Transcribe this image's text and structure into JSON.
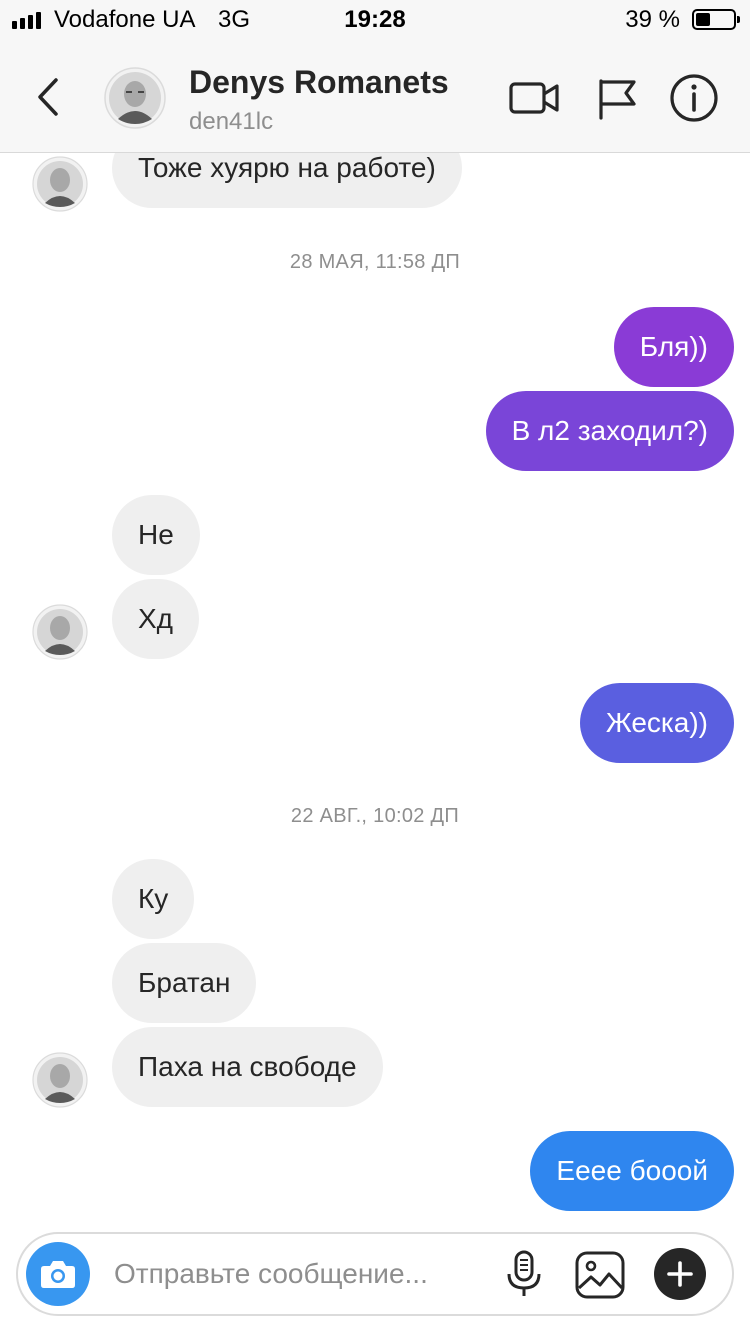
{
  "status_bar": {
    "carrier": "Vodafone UA",
    "network": "3G",
    "time": "19:28",
    "battery_text": "39 %",
    "battery_level": 0.39
  },
  "header": {
    "name": "Denys Romanets",
    "username": "den41lc",
    "icons": [
      "back-chevron-icon",
      "video-camera-icon",
      "flag-icon",
      "info-icon"
    ]
  },
  "messages": [
    {
      "direction": "in",
      "text": "Тоже хуярю на работе)"
    },
    {
      "type": "timestamp",
      "text": "28 МАЯ, 11:58 ДП"
    },
    {
      "direction": "out",
      "text": "Бля))",
      "color": "#8a3bd6"
    },
    {
      "direction": "out",
      "text": "В л2 заходил?)",
      "color": "#7a45d8"
    },
    {
      "direction": "in",
      "text": "Не"
    },
    {
      "direction": "in",
      "text": "Хд"
    },
    {
      "direction": "out",
      "text": "Жеска))",
      "color": "#5a5fe0"
    },
    {
      "type": "timestamp",
      "text": "22 АВГ., 10:02 ДП"
    },
    {
      "direction": "in",
      "text": "Ку"
    },
    {
      "direction": "in",
      "text": "Братан"
    },
    {
      "direction": "in",
      "text": "Паха на свободе"
    },
    {
      "direction": "out",
      "text": "Еeee бoooй",
      "color": "#2f86ef"
    }
  ],
  "composer": {
    "placeholder": "Отправьте сообщение...",
    "value": "",
    "icons": [
      "camera-icon",
      "microphone-icon",
      "gallery-icon",
      "plus-icon"
    ]
  },
  "colors": {
    "incoming_bubble": "#efefef",
    "camera_button": "#3897f0",
    "timestamp_text": "#8e8e8e"
  }
}
